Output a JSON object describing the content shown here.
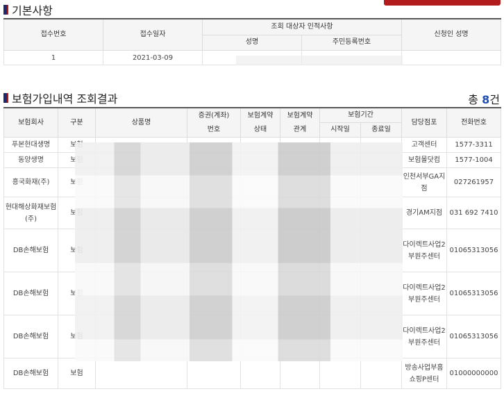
{
  "basic": {
    "title": "기본사항",
    "headers": {
      "receipt_no": "접수번호",
      "receipt_date": "접수일자",
      "target": "조회 대상자 인적사항",
      "name": "성명",
      "rrn": "주민등록번호",
      "applicant": "신청인 성명"
    },
    "row": {
      "receipt_no": "1",
      "receipt_date": "2021-03-09"
    }
  },
  "result": {
    "title": "보험가입내역 조회결과",
    "count_prefix": "총",
    "count_num": "8",
    "count_suffix": "건",
    "headers": {
      "company": "보험회사",
      "category": "구분",
      "product": "상품명",
      "policy_no_1": "증권(계좌)",
      "policy_no_2": "번호",
      "status_1": "보험계약",
      "status_2": "상태",
      "relation_1": "보험계약",
      "relation_2": "관계",
      "period": "보험기간",
      "start": "시작일",
      "end": "종료일",
      "branch": "담당점포",
      "phone": "전화번호"
    },
    "rows": [
      {
        "company": "푸본현대생명",
        "category": "보험",
        "branch": "고객센터",
        "phone": "1577-3311"
      },
      {
        "company": "동양생명",
        "category": "보험",
        "branch": "보험몰닷컴",
        "phone": "1577-1004"
      },
      {
        "company": "흥국화재(주)",
        "category": "보험",
        "branch": "인천서부GA지점",
        "phone": "027261957"
      },
      {
        "company": "현대해상화재보험(주)",
        "category": "보험",
        "branch": "경기AM지점",
        "phone": "031 692 7410"
      },
      {
        "company": "DB손해보험",
        "category": "보험",
        "branch": "다이렉트사업2부원주센터",
        "phone": "01065313056"
      },
      {
        "company": "DB손해보험",
        "category": "보험",
        "branch": "다이렉트사업2부원주센터",
        "phone": "01065313056"
      },
      {
        "company": "DB손해보험",
        "category": "보험",
        "branch": "다이렉트사업2부원주센터",
        "phone": "01065313056"
      },
      {
        "company": "DB손해보험",
        "category": "보험",
        "branch": "방송사업부홈쇼핑P센터",
        "phone": "01000000000"
      }
    ]
  }
}
